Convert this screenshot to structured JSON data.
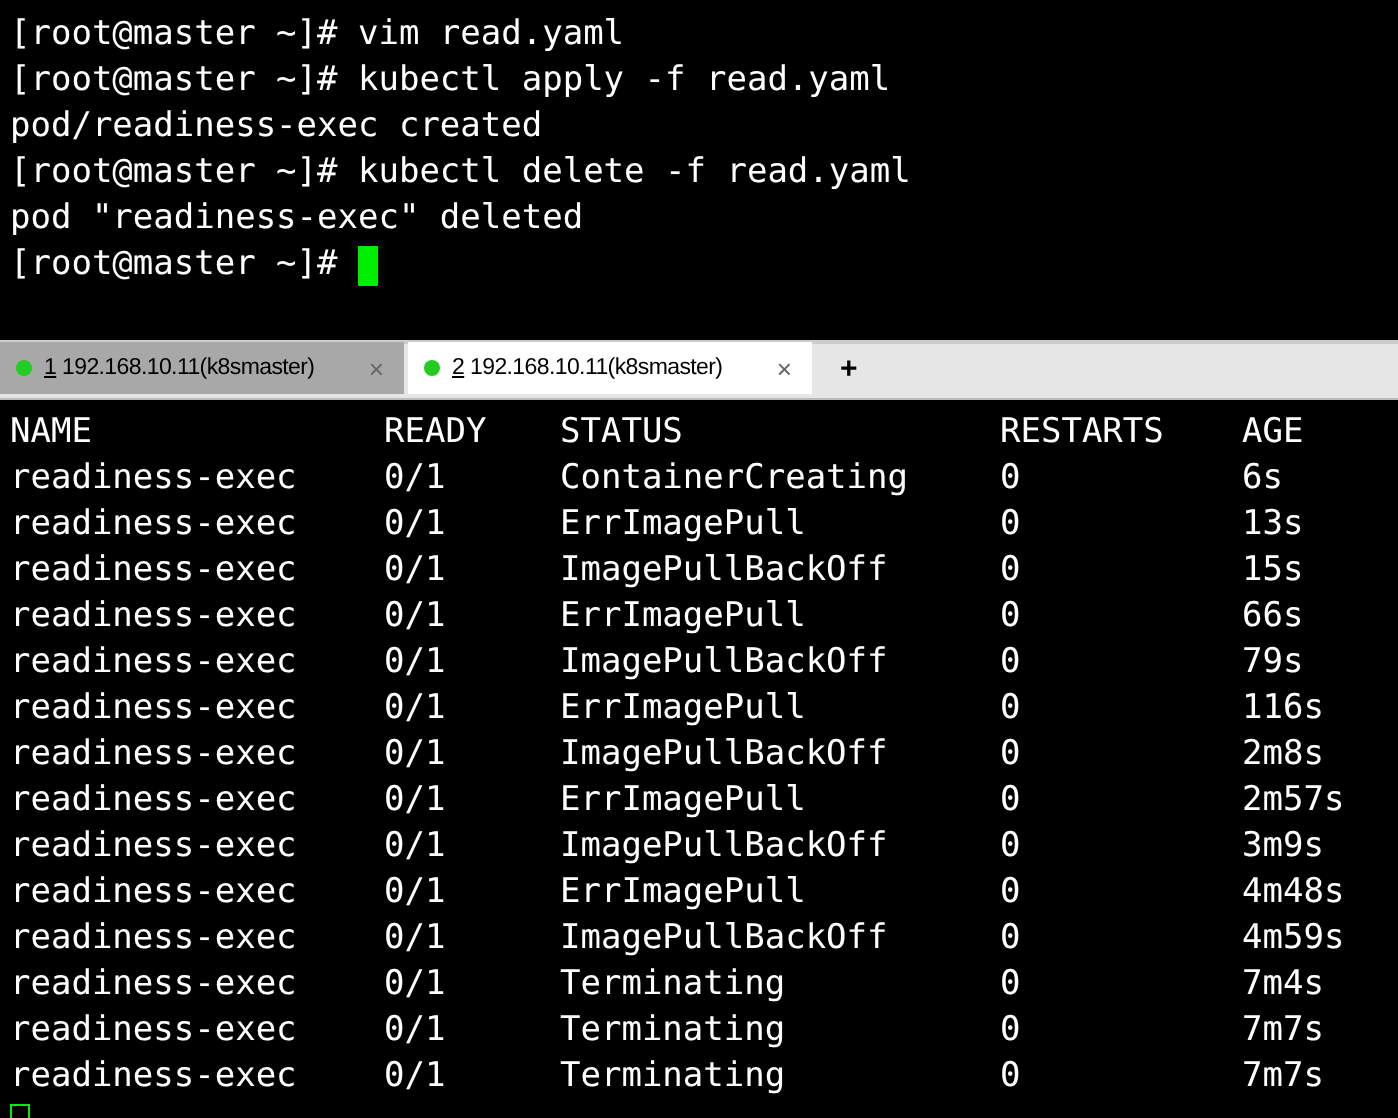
{
  "top_terminal": {
    "lines": [
      "[root@master ~]# vim read.yaml",
      "[root@master ~]# kubectl apply -f read.yaml",
      "pod/readiness-exec created",
      "[root@master ~]# kubectl delete -f read.yaml",
      "pod \"readiness-exec\" deleted"
    ],
    "prompt": "[root@master ~]# ",
    "cursor_focused": true
  },
  "tabs": [
    {
      "number": "1",
      "title": " 192.168.10.11(k8smaster)",
      "close": "×",
      "selected": false,
      "color": "#22cc22"
    },
    {
      "number": "2",
      "title": " 192.168.10.11(k8smaster)",
      "close": "×",
      "selected": true,
      "color": "#22cc22"
    }
  ],
  "new_tab": "+",
  "pods_table": {
    "columns": [
      "NAME",
      "READY",
      "STATUS",
      "RESTARTS",
      "AGE"
    ],
    "rows": [
      [
        "readiness-exec",
        "0/1",
        "ContainerCreating",
        "0",
        "6s"
      ],
      [
        "readiness-exec",
        "0/1",
        "ErrImagePull",
        "0",
        "13s"
      ],
      [
        "readiness-exec",
        "0/1",
        "ImagePullBackOff",
        "0",
        "15s"
      ],
      [
        "readiness-exec",
        "0/1",
        "ErrImagePull",
        "0",
        "66s"
      ],
      [
        "readiness-exec",
        "0/1",
        "ImagePullBackOff",
        "0",
        "79s"
      ],
      [
        "readiness-exec",
        "0/1",
        "ErrImagePull",
        "0",
        "116s"
      ],
      [
        "readiness-exec",
        "0/1",
        "ImagePullBackOff",
        "0",
        "2m8s"
      ],
      [
        "readiness-exec",
        "0/1",
        "ErrImagePull",
        "0",
        "2m57s"
      ],
      [
        "readiness-exec",
        "0/1",
        "ImagePullBackOff",
        "0",
        "3m9s"
      ],
      [
        "readiness-exec",
        "0/1",
        "ErrImagePull",
        "0",
        "4m48s"
      ],
      [
        "readiness-exec",
        "0/1",
        "ImagePullBackOff",
        "0",
        "4m59s"
      ],
      [
        "readiness-exec",
        "0/1",
        "Terminating",
        "0",
        "7m4s"
      ],
      [
        "readiness-exec",
        "0/1",
        "Terminating",
        "0",
        "7m7s"
      ],
      [
        "readiness-exec",
        "0/1",
        "Terminating",
        "0",
        "7m7s"
      ]
    ],
    "cursor_focused": false
  }
}
